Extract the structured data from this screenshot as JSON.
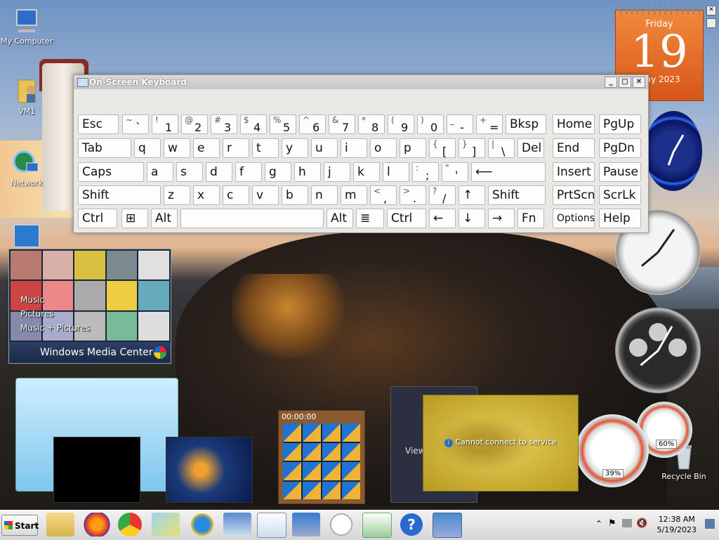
{
  "desktop": {
    "icons": [
      {
        "label": "My Computer"
      },
      {
        "label": "VM1"
      },
      {
        "label": "Network"
      },
      {
        "label": "Recycle Bin"
      }
    ]
  },
  "osk": {
    "title": "On-Screen Keyboard",
    "row1": [
      {
        "main": "Esc"
      },
      {
        "up": "~",
        "lo": "`"
      },
      {
        "up": "!",
        "lo": "1"
      },
      {
        "up": "@",
        "lo": "2"
      },
      {
        "up": "#",
        "lo": "3"
      },
      {
        "up": "$",
        "lo": "4"
      },
      {
        "up": "%",
        "lo": "5"
      },
      {
        "up": "^",
        "lo": "6"
      },
      {
        "up": "&",
        "lo": "7"
      },
      {
        "up": "*",
        "lo": "8"
      },
      {
        "up": "(",
        "lo": "9"
      },
      {
        "up": ")",
        "lo": "0"
      },
      {
        "up": "_",
        "lo": "-"
      },
      {
        "up": "+",
        "lo": "="
      },
      {
        "main": "Bksp"
      },
      {
        "main": "Home"
      },
      {
        "main": "PgUp"
      }
    ],
    "row2": [
      {
        "main": "Tab"
      },
      {
        "main": "q"
      },
      {
        "main": "w"
      },
      {
        "main": "e"
      },
      {
        "main": "r"
      },
      {
        "main": "t"
      },
      {
        "main": "y"
      },
      {
        "main": "u"
      },
      {
        "main": "i"
      },
      {
        "main": "o"
      },
      {
        "main": "p"
      },
      {
        "up": "{",
        "lo": "["
      },
      {
        "up": "}",
        "lo": "]"
      },
      {
        "up": "|",
        "lo": "\\"
      },
      {
        "main": "Del"
      },
      {
        "main": "End"
      },
      {
        "main": "PgDn"
      }
    ],
    "row3": [
      {
        "main": "Caps"
      },
      {
        "main": "a"
      },
      {
        "main": "s"
      },
      {
        "main": "d"
      },
      {
        "main": "f"
      },
      {
        "main": "g"
      },
      {
        "main": "h"
      },
      {
        "main": "j"
      },
      {
        "main": "k"
      },
      {
        "main": "l"
      },
      {
        "up": ":",
        "lo": ";"
      },
      {
        "up": "\"",
        "lo": "'"
      },
      {
        "main": "⟵"
      },
      {
        "main": "Insert"
      },
      {
        "main": "Pause"
      }
    ],
    "row4": [
      {
        "main": "Shift"
      },
      {
        "main": "z"
      },
      {
        "main": "x"
      },
      {
        "main": "c"
      },
      {
        "main": "v"
      },
      {
        "main": "b"
      },
      {
        "main": "n"
      },
      {
        "main": "m"
      },
      {
        "up": "<",
        "lo": ","
      },
      {
        "up": ">",
        "lo": "."
      },
      {
        "up": "?",
        "lo": "/"
      },
      {
        "main": "↑"
      },
      {
        "main": "Shift"
      },
      {
        "main": "PrtScn"
      },
      {
        "main": "ScrLk"
      }
    ],
    "row5": [
      {
        "main": "Ctrl"
      },
      {
        "main": "⊞"
      },
      {
        "main": "Alt"
      },
      {
        "main": ""
      },
      {
        "main": "Alt"
      },
      {
        "main": "≣"
      },
      {
        "main": "Ctrl"
      },
      {
        "main": "←"
      },
      {
        "main": "↓"
      },
      {
        "main": "→"
      },
      {
        "main": "Fn"
      },
      {
        "main": "Options"
      },
      {
        "main": "Help"
      }
    ]
  },
  "gadgets": {
    "calendar": {
      "weekday": "Friday",
      "day": "19",
      "month_year": "May 2023"
    },
    "media_center": {
      "items": [
        "Music",
        "Pictures",
        "Music + Pictures"
      ],
      "brand_pre": "Windows ",
      "brand_post": "Media Center"
    },
    "puzzle": {
      "timer": "00:00:00"
    },
    "feed": {
      "label": "View"
    },
    "stocks": {
      "message": "Cannot connect to service"
    },
    "cpu_meter": {
      "cpu": "39%",
      "ram": "60%"
    }
  },
  "taskbar": {
    "start_label": "Start",
    "clock_time": "12:38 AM",
    "clock_date": "5/19/2023"
  },
  "colors": {
    "accent": "#d8561a",
    "taskbar": "#d6d6d6"
  }
}
